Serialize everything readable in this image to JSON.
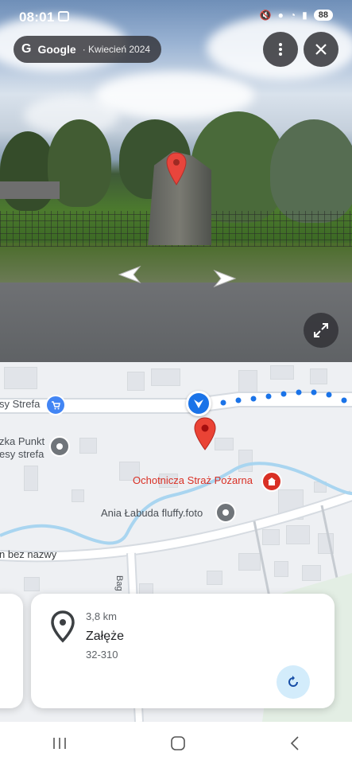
{
  "status_bar": {
    "time": "08:01",
    "battery": "88"
  },
  "street_view": {
    "brand": "Google",
    "date": "· Kwiecień 2024",
    "icons": [
      "screenshot-icon",
      "more-vert-icon",
      "close-icon",
      "arrow-left-icon",
      "arrow-right-icon",
      "expand-icon",
      "location-pin-icon"
    ]
  },
  "map": {
    "labels": {
      "shop_top": "sy Strefa",
      "shop2_line1": "zka Punkt",
      "shop2_line2": "esy strefa",
      "fire_station": "Ochotnicza Straż Pożarna",
      "photo_poi": "Ania Łabuda fluffy.foto",
      "road_unnamed": "n bez nazwy",
      "road_vertical": "Bag"
    },
    "colors": {
      "route_dot": "#1a73e8",
      "pin": "#ea4335",
      "fire": "#d93025",
      "shop": "#4285f4",
      "poi_gray": "#70757a",
      "water": "#a9d5f0"
    }
  },
  "place_card": {
    "distance": "3,8 km",
    "name": "Załęże",
    "postal": "32-310"
  },
  "nav_bar": {
    "icons": [
      "recents-icon",
      "home-icon",
      "back-icon"
    ]
  }
}
